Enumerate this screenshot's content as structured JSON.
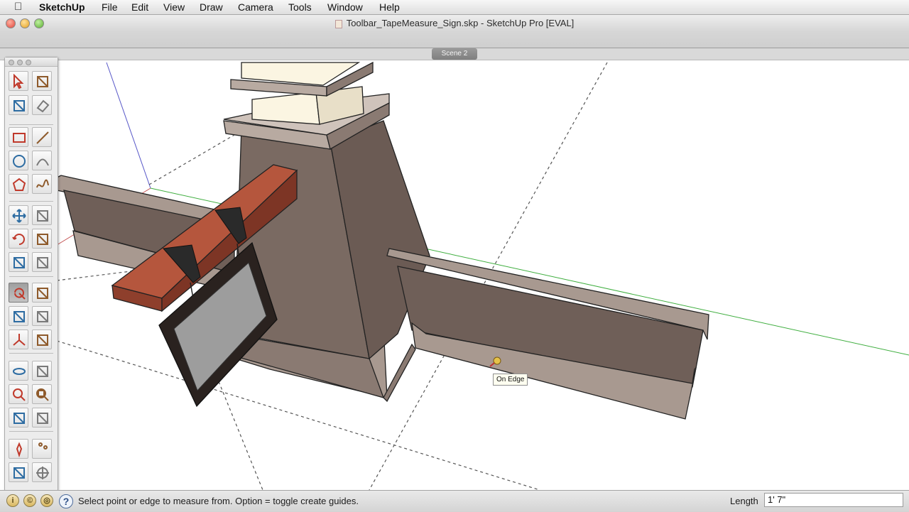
{
  "menubar": {
    "app": "SketchUp",
    "items": [
      "File",
      "Edit",
      "View",
      "Draw",
      "Camera",
      "Tools",
      "Window",
      "Help"
    ]
  },
  "window": {
    "title": "Toolbar_TapeMeasure_Sign.skp - SketchUp Pro [EVAL]"
  },
  "scenes": {
    "tabs": [
      "Scene 2"
    ]
  },
  "canvas": {
    "tooltip": "On Edge"
  },
  "tools": {
    "icons": [
      "select-icon",
      "make-component-icon",
      "paint-bucket-icon",
      "eraser-icon",
      "rectangle-icon",
      "line-icon",
      "circle-icon",
      "arc-icon",
      "polygon-icon",
      "freehand-icon",
      "move-icon",
      "push-pull-icon",
      "rotate-icon",
      "follow-me-icon",
      "scale-icon",
      "offset-icon",
      "tape-measure-icon",
      "dimension-icon",
      "protractor-icon",
      "text-icon",
      "axes-icon",
      "3d-text-icon",
      "orbit-icon",
      "pan-icon",
      "zoom-icon",
      "zoom-window-icon",
      "zoom-extents-icon",
      "previous-view-icon",
      "position-camera-icon",
      "walk-icon",
      "look-around-icon",
      "section-plane-icon"
    ],
    "active": "tape-measure-icon"
  },
  "statusbar": {
    "message": "Select point or edge to measure from.  Option = toggle create guides.",
    "length_label": "Length",
    "length_value": "1' 7\"",
    "help_glyph": "?"
  },
  "colors": {
    "model_brown": "#7a6a62",
    "model_light": "#a89990",
    "beam_red": "#9a4a34",
    "pillar_cream": "#fbf5e2",
    "sign_gray": "#9d9d9d",
    "green_axis": "#3fae3f",
    "blue_axis": "#5757c8",
    "red_axis": "#c45252"
  }
}
